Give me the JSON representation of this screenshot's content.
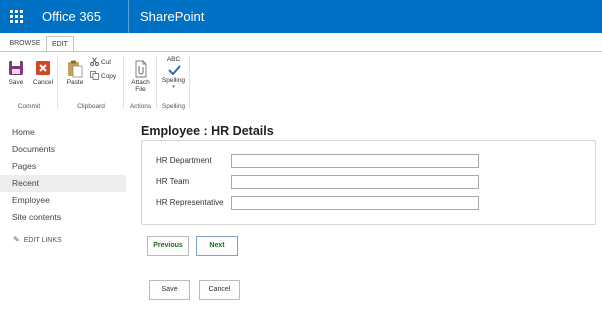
{
  "suite": {
    "app_name": "Office 365",
    "site_name": "SharePoint",
    "brand_color": "#0072c6"
  },
  "ribbon": {
    "tabs": [
      {
        "label": "BROWSE",
        "selected": false
      },
      {
        "label": "EDIT",
        "selected": true
      }
    ],
    "groups": {
      "commit": {
        "label": "Commit",
        "save": "Save",
        "cancel": "Cancel"
      },
      "clipboard": {
        "label": "Clipboard",
        "paste": "Paste",
        "cut": "Cut",
        "copy": "Copy"
      },
      "actions": {
        "label": "Actions",
        "attach_line1": "Attach",
        "attach_line2": "File"
      },
      "spelling": {
        "label": "Spelling",
        "abc": "ABC",
        "spelling": "Spelling"
      }
    },
    "icons": [
      "save-icon",
      "cancel-icon",
      "paste-icon",
      "cut-icon",
      "copy-icon",
      "attach-file-icon",
      "spelling-icon"
    ]
  },
  "nav": {
    "items": [
      {
        "label": "Home",
        "selected": false
      },
      {
        "label": "Documents",
        "selected": false
      },
      {
        "label": "Pages",
        "selected": false
      },
      {
        "label": "Recent",
        "selected": true
      },
      {
        "label": "Employee",
        "selected": false
      },
      {
        "label": "Site contents",
        "selected": false
      }
    ],
    "edit_links": "EDIT LINKS"
  },
  "form": {
    "title": "Employee : HR Details",
    "fields": [
      {
        "label": "HR Department",
        "value": ""
      },
      {
        "label": "HR Team",
        "value": ""
      },
      {
        "label": "HR Representative",
        "value": ""
      }
    ],
    "previous": "Previous",
    "next": "Next",
    "save": "Save",
    "cancel": "Cancel"
  },
  "colors": {
    "nav_selected_bg": "#ededed",
    "step_button_text": "#1b6d1b",
    "save_icon": "#80397b",
    "cancel_icon": "#d24726"
  }
}
